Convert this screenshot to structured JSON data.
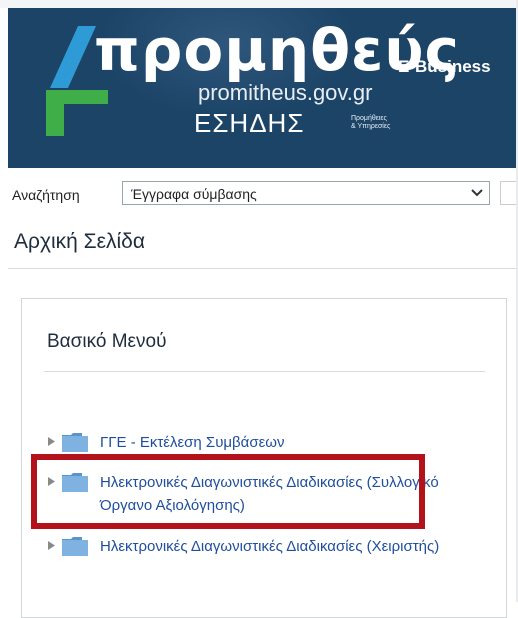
{
  "header": {
    "logo_word": "προμηθεύς",
    "logo_domain": "promitheus.gov.gr",
    "logo_org": "ΕΣΗΔΗΣ",
    "logo_sub_line1": "Προμήθειες",
    "logo_sub_line2": "& Υπηρεσίες",
    "product_label": "E-Business",
    "colors": {
      "banner": "#1c4467",
      "logo_blue": "#2f9bd6",
      "logo_green": "#3fae49"
    }
  },
  "search": {
    "label": "Αναζήτηση",
    "selected_option": "Έγγραφα σύμβασης",
    "icon": "chevron-down-icon"
  },
  "page": {
    "title": "Αρχική Σελίδα"
  },
  "menu": {
    "title": "Βασικό Μενού",
    "items": [
      {
        "label": "ΓΓΕ - Εκτέλεση Συμβάσεων",
        "icon": "folder-icon"
      },
      {
        "label": "Ηλεκτρονικές Διαγωνιστικές Διαδικασίες (Συλλογικό Όργανο Αξιολόγησης)",
        "icon": "folder-icon",
        "highlighted": true
      },
      {
        "label": "Ηλεκτρονικές Διαγωνιστικές Διαδικασίες (Χειριστής)",
        "icon": "folder-icon"
      }
    ],
    "colors": {
      "link": "#1f4e9d",
      "highlight": "#b3121a",
      "folder": "#6fa8dc"
    }
  }
}
